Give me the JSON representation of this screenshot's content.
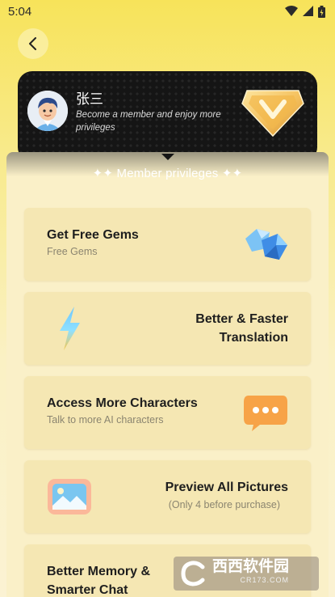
{
  "status_bar": {
    "time": "5:04",
    "icons": [
      "wifi-icon",
      "signal-icon",
      "battery-icon"
    ]
  },
  "header": {
    "back_icon": "chevron-left-icon"
  },
  "member_card": {
    "user_name": "张三",
    "subtitle": "Become a member and enjoy more privileges",
    "badge_icon": "vip-v-badge-icon"
  },
  "privileges": {
    "title": "✦✦ Member privileges ✦✦",
    "items": [
      {
        "title": "Get  Free Gems",
        "subtitle": "Free Gems",
        "icon": "gems-icon"
      },
      {
        "title": "Better & Faster Translation",
        "subtitle": "",
        "icon": "lightning-icon"
      },
      {
        "title": "Access More Characters",
        "subtitle": "Talk to more AI characters",
        "icon": "chat-bubble-icon"
      },
      {
        "title": "Preview All Pictures",
        "subtitle": "(Only 4 before purchase)",
        "icon": "picture-icon"
      },
      {
        "title": "Better Memory & Smarter Chat",
        "subtitle": "",
        "icon": "memory-icon"
      }
    ]
  },
  "watermark": {
    "text": "西西软件园",
    "subtext": "CR173.COM"
  },
  "colors": {
    "accent": "#f7e35a",
    "card": "#f5e7b3",
    "dark": "#151515",
    "chat_orange": "#f7a347",
    "gem_blue": "#3f8de6"
  }
}
